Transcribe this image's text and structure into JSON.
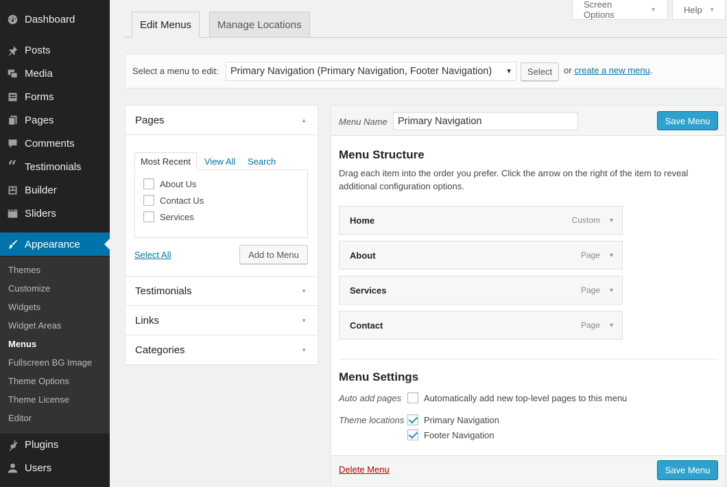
{
  "sidebar": {
    "items": [
      {
        "label": "Dashboard",
        "icon": "dashboard-icon"
      },
      {
        "label": "Posts",
        "icon": "pin-icon"
      },
      {
        "label": "Media",
        "icon": "media-icon"
      },
      {
        "label": "Forms",
        "icon": "forms-icon"
      },
      {
        "label": "Pages",
        "icon": "pages-icon"
      },
      {
        "label": "Comments",
        "icon": "comments-icon"
      },
      {
        "label": "Testimonials",
        "icon": "quote-icon"
      },
      {
        "label": "Builder",
        "icon": "builder-icon"
      },
      {
        "label": "Sliders",
        "icon": "sliders-icon"
      },
      {
        "label": "Appearance",
        "icon": "brush-icon"
      },
      {
        "label": "Plugins",
        "icon": "plugin-icon"
      },
      {
        "label": "Users",
        "icon": "user-icon"
      }
    ],
    "submenu": [
      "Themes",
      "Customize",
      "Widgets",
      "Widget Areas",
      "Menus",
      "Fullscreen BG Image",
      "Theme Options",
      "Theme License",
      "Editor"
    ],
    "active_color": "#0073aa"
  },
  "screen_meta": {
    "screen_options": "Screen Options",
    "help": "Help"
  },
  "nav_tabs": {
    "edit_menus": "Edit Menus",
    "manage_locations": "Manage Locations"
  },
  "manage": {
    "select_label": "Select a menu to edit:",
    "selected_menu": "Primary Navigation (Primary Navigation, Footer Navigation)",
    "select_button": "Select",
    "or_text": "or",
    "create_link": "create a new menu",
    "period": "."
  },
  "accordion": {
    "pages_title": "Pages",
    "tabs": [
      "Most Recent",
      "View All",
      "Search"
    ],
    "pages": [
      {
        "label": "About Us",
        "checked": false
      },
      {
        "label": "Contact Us",
        "checked": false
      },
      {
        "label": "Services",
        "checked": false
      }
    ],
    "select_all": "Select All",
    "add_to_menu": "Add to Menu",
    "sections": [
      "Testimonials",
      "Links",
      "Categories"
    ]
  },
  "editor": {
    "menu_name_label": "Menu Name",
    "menu_name_value": "Primary Navigation",
    "save_button": "Save Menu",
    "structure_title": "Menu Structure",
    "structure_desc": "Drag each item into the order you prefer. Click the arrow on the right of the item to reveal additional configuration options.",
    "items": [
      {
        "title": "Home",
        "type": "Custom"
      },
      {
        "title": "About",
        "type": "Page"
      },
      {
        "title": "Services",
        "type": "Page"
      },
      {
        "title": "Contact",
        "type": "Page"
      }
    ],
    "settings_title": "Menu Settings",
    "auto_add_label": "Auto add pages",
    "auto_add_text": "Automatically add new top-level pages to this menu",
    "theme_locations_label": "Theme locations",
    "locations": [
      {
        "label": "Primary Navigation",
        "checked": true
      },
      {
        "label": "Footer Navigation",
        "checked": true
      }
    ],
    "delete_link": "Delete Menu"
  }
}
